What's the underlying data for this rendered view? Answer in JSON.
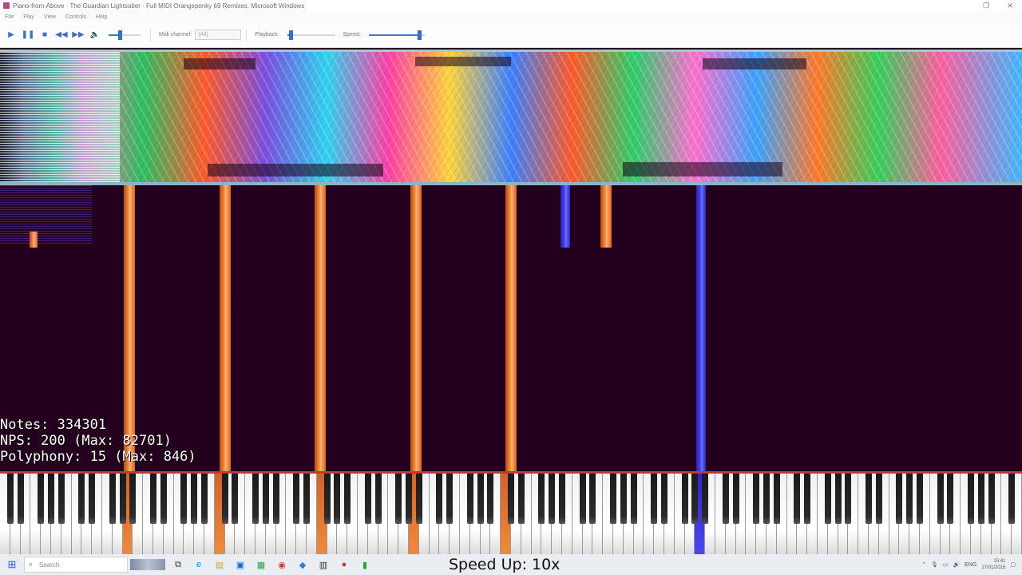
{
  "window": {
    "title": "Piano-from-Above · The Guardian Lightsaber · Full MIDI Orangeponky 69 Remixes. Microsoft Windows",
    "minimize_icon": "minimize-icon",
    "close_icon": "close-icon"
  },
  "menu": {
    "items": [
      "File",
      "Play",
      "View",
      "Controls",
      "Help"
    ]
  },
  "toolbar": {
    "midi_channel_label": "Midi channel:",
    "midi_channel_value": "(All)",
    "playback_label": "Playback:",
    "speed_label": "Speed:",
    "volume_level": 0.35,
    "playback_level": 0.08,
    "speed_level": 0.9
  },
  "stats": {
    "notes": "Notes: 334301",
    "nps": "NPS: 200 (Max: 82701)",
    "polyphony": "Polyphony: 15 (Max: 846)"
  },
  "overlay": {
    "speed_text": "Speed Up: 10x"
  },
  "taskbar": {
    "search_placeholder": "Search",
    "tray_lang": "ENG",
    "clock_time": "15:41",
    "clock_date": "17/01/2016"
  },
  "colors": {
    "note_orange": "#f08a3a",
    "note_blue": "#4a46f0",
    "background": "#24001f",
    "accent": "#2f6ed3"
  }
}
